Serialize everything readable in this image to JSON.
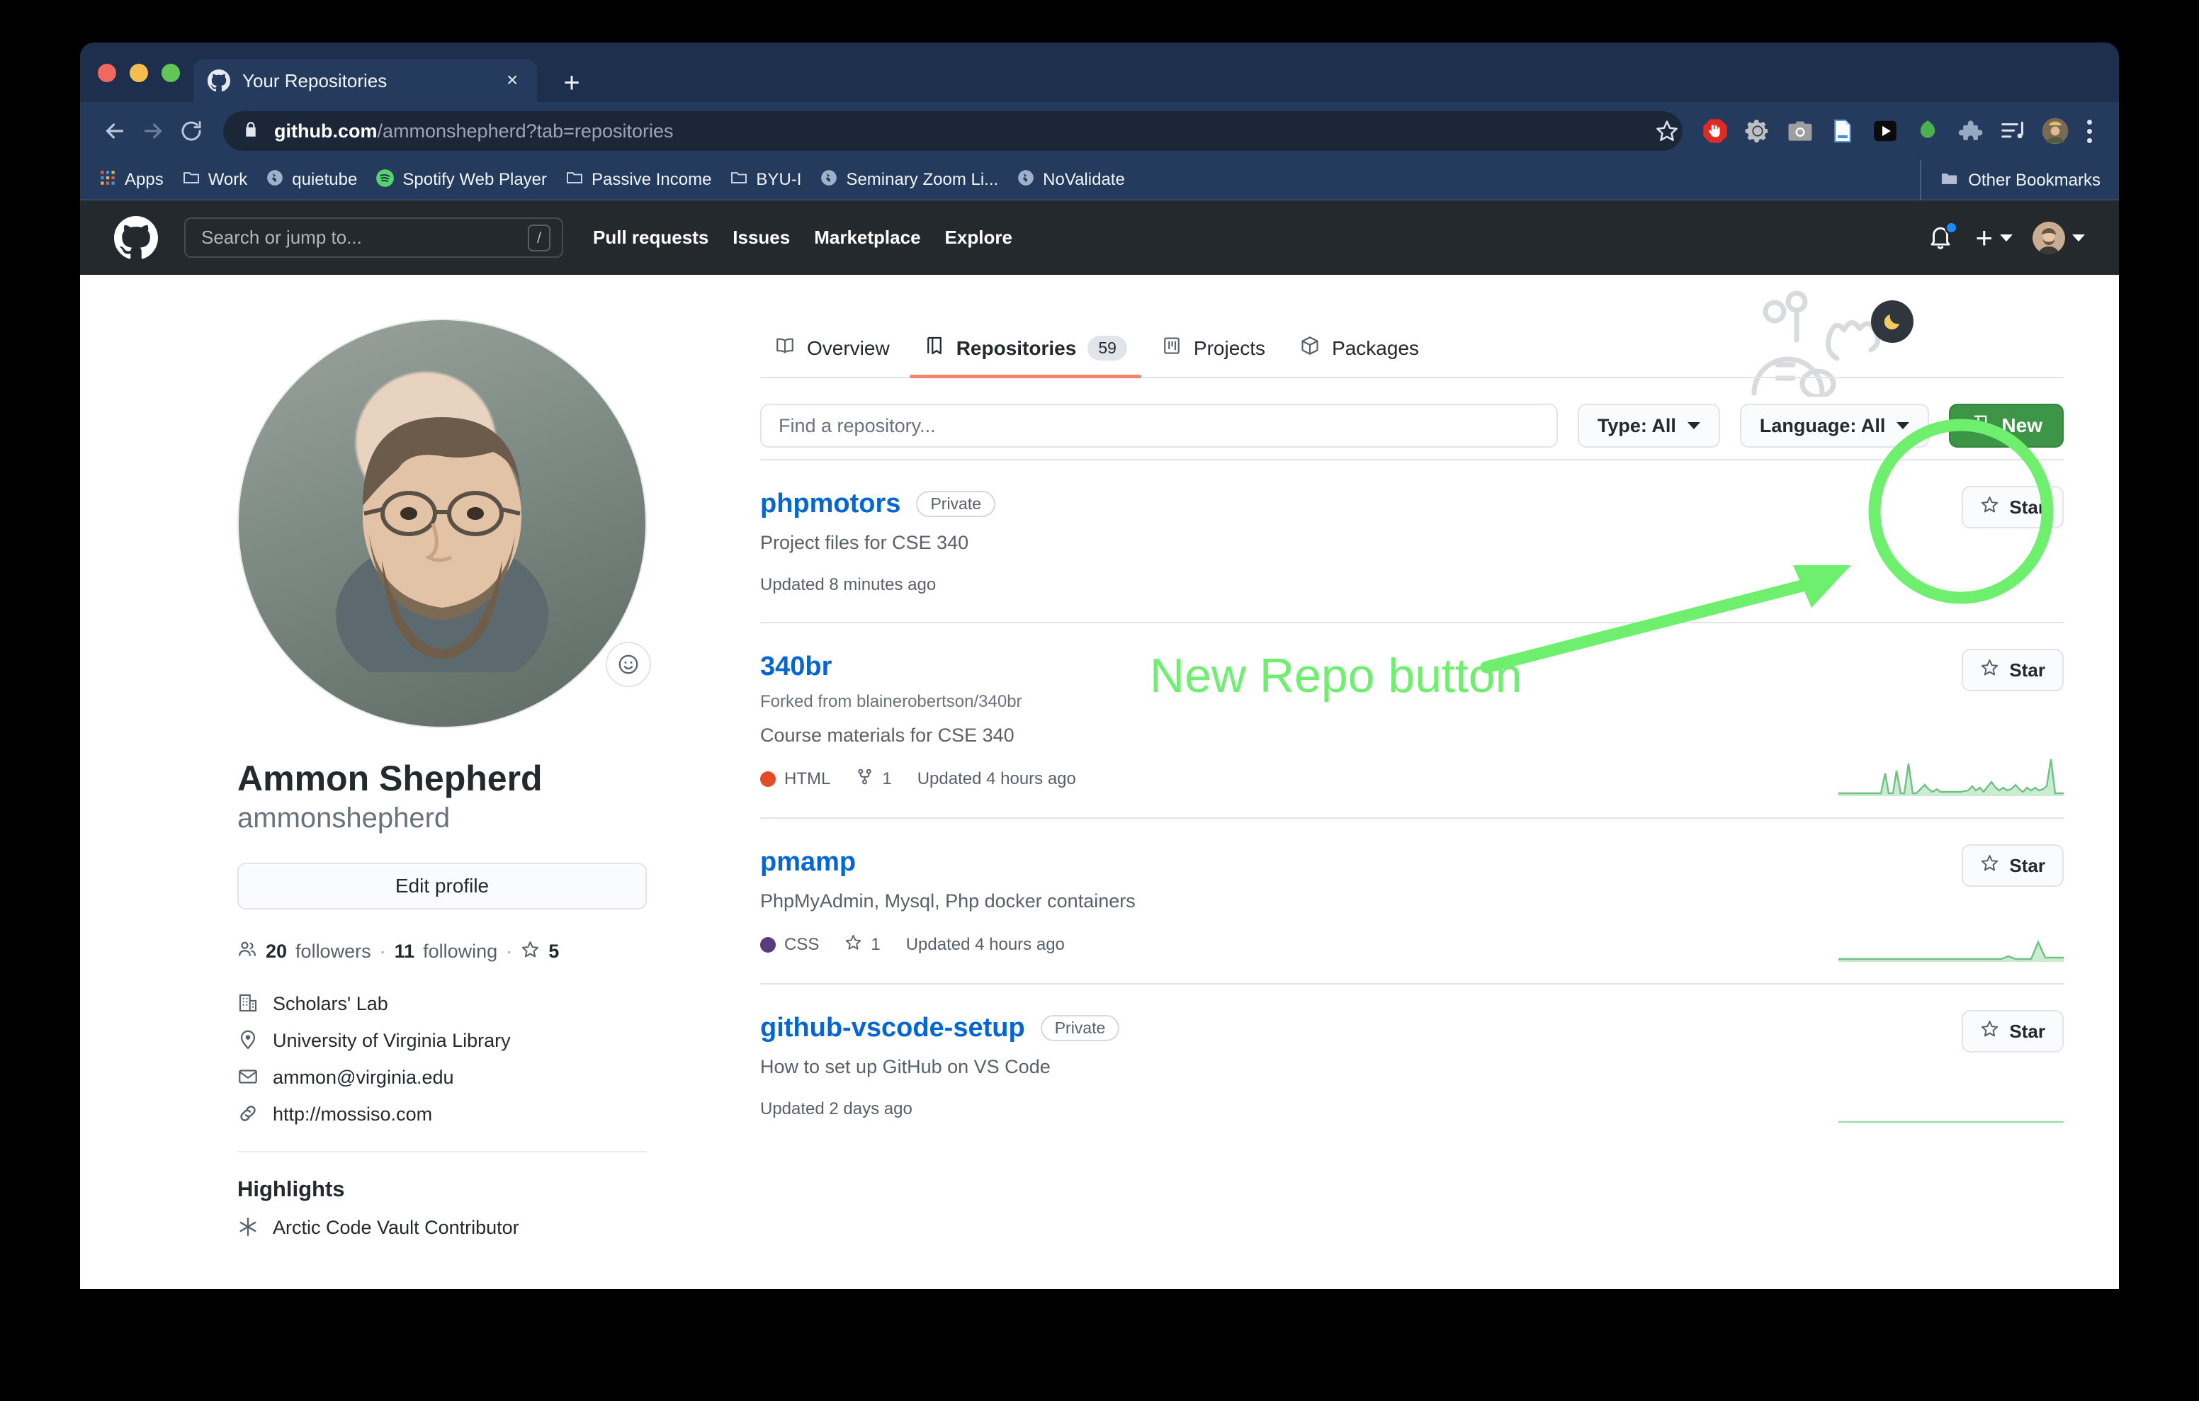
{
  "browser": {
    "tab": {
      "title": "Your Repositories",
      "favicon": "github-icon",
      "close": "×"
    },
    "new_tab_label": "+",
    "traffic_lights": [
      {
        "name": "close",
        "color": "#f2685e"
      },
      {
        "name": "minimize",
        "color": "#f5bd4f"
      },
      {
        "name": "maximize",
        "color": "#62c554"
      }
    ],
    "nav": {
      "back": "←",
      "forward": "→",
      "reload": "⟳"
    },
    "url": {
      "host": "github.com",
      "path": "/ammonshepherd?tab=repositories"
    },
    "extensions": [
      {
        "name": "adblock-icon"
      },
      {
        "name": "gear-icon"
      },
      {
        "name": "camera-icon"
      },
      {
        "name": "document-icon"
      },
      {
        "name": "play-icon"
      },
      {
        "name": "green-drop-icon"
      },
      {
        "name": "puzzle-icon"
      },
      {
        "name": "playlist-icon"
      },
      {
        "name": "profile-avatar-icon"
      }
    ],
    "bookmarks": [
      {
        "label": "Apps",
        "icon": "apps-grid-icon"
      },
      {
        "label": "Work",
        "icon": "folder-icon"
      },
      {
        "label": "quietube",
        "icon": "globe-icon"
      },
      {
        "label": "Spotify Web Player",
        "icon": "spotify-icon"
      },
      {
        "label": "Passive Income",
        "icon": "folder-icon"
      },
      {
        "label": "BYU-I",
        "icon": "folder-icon"
      },
      {
        "label": "Seminary Zoom Li...",
        "icon": "globe-icon"
      },
      {
        "label": "NoValidate",
        "icon": "globe-icon"
      }
    ],
    "other_bookmarks": {
      "label": "Other Bookmarks",
      "icon": "folder-icon"
    }
  },
  "github": {
    "header": {
      "logo": "github-mark-icon",
      "search_placeholder": "Search or jump to...",
      "search_shortcut": "/",
      "nav": [
        {
          "label": "Pull requests"
        },
        {
          "label": "Issues"
        },
        {
          "label": "Marketplace"
        },
        {
          "label": "Explore"
        }
      ],
      "bell": "notifications-bell-icon",
      "plus": "+",
      "avatar": "user-avatar-icon"
    },
    "profile": {
      "name": "Ammon Shepherd",
      "login": "ammonshepherd",
      "edit_button": "Edit profile",
      "stats": {
        "followers_count": "20",
        "followers_label": "followers",
        "following_count": "11",
        "following_label": "following",
        "stars_count": "5"
      },
      "details": [
        {
          "icon": "organization-icon",
          "text": "Scholars' Lab"
        },
        {
          "icon": "location-icon",
          "text": "University of Virginia Library"
        },
        {
          "icon": "mail-icon",
          "text": "ammon@virginia.edu"
        },
        {
          "icon": "link-icon",
          "text": "http://mossiso.com"
        }
      ],
      "highlights_title": "Highlights",
      "highlights": [
        {
          "icon": "arctic-vault-icon",
          "text": "Arctic Code Vault Contributor"
        }
      ]
    },
    "tabs": [
      {
        "label": "Overview",
        "icon": "book-icon",
        "count": null,
        "active": false
      },
      {
        "label": "Repositories",
        "icon": "repo-icon",
        "count": "59",
        "active": true
      },
      {
        "label": "Projects",
        "icon": "project-icon",
        "count": null,
        "active": false
      },
      {
        "label": "Packages",
        "icon": "package-icon",
        "count": null,
        "active": false
      }
    ],
    "filters": {
      "find_placeholder": "Find a repository...",
      "type_label": "Type: All",
      "language_label": "Language: All",
      "new_button": "New",
      "new_button_icon": "repo-icon",
      "new_button_color": "#3d9648"
    },
    "dark_mode_toggle": "moon-icon",
    "star_button_label": "Star",
    "repositories": [
      {
        "name": "phpmotors",
        "badge": "Private",
        "forked_from": null,
        "description": "Project files for CSE 340",
        "language": null,
        "language_color": null,
        "forks": null,
        "stars": null,
        "updated": "Updated 8 minutes ago",
        "star_label": "Star",
        "sparkline": null
      },
      {
        "name": "340br",
        "badge": null,
        "forked_from": "Forked from blainerobertson/340br",
        "description": "Course materials for CSE 340",
        "language": "HTML",
        "language_color": "#e34c26",
        "forks": "1",
        "stars": null,
        "updated": "Updated 4 hours ago",
        "star_label": "Star",
        "sparkline": [
          2,
          2,
          2,
          2,
          2,
          2,
          2,
          2,
          2,
          2,
          2,
          2,
          2,
          2,
          2,
          2,
          2,
          2,
          2,
          2,
          2,
          22,
          2,
          2,
          30,
          2,
          2,
          38,
          2,
          2,
          2,
          2,
          8,
          2,
          4,
          2,
          2,
          2,
          2,
          2,
          2,
          2,
          2,
          2,
          2,
          2,
          8,
          4,
          10,
          4,
          12,
          6,
          14,
          4,
          2,
          2,
          2,
          32
        ]
      },
      {
        "name": "pmamp",
        "badge": null,
        "forked_from": null,
        "description": "PhpMyAdmin, Mysql, Php docker containers",
        "language": "CSS",
        "language_color": "#563d7c",
        "forks": null,
        "stars": "1",
        "updated": "Updated 4 hours ago",
        "star_label": "Star",
        "sparkline": [
          2,
          2,
          2,
          2,
          2,
          2,
          2,
          2,
          2,
          2,
          2,
          2,
          2,
          2,
          2,
          2,
          2,
          2,
          2,
          2,
          2,
          2,
          2,
          2,
          2,
          2,
          2,
          2,
          2,
          2,
          2,
          2,
          2,
          2,
          2,
          2,
          2,
          2,
          2,
          2,
          2,
          2,
          2,
          2,
          2,
          2,
          2,
          2,
          2,
          4,
          2,
          2,
          2,
          2,
          2,
          2,
          22,
          4
        ]
      },
      {
        "name": "github-vscode-setup",
        "badge": "Private",
        "forked_from": null,
        "description": "How to set up GitHub on VS Code",
        "language": null,
        "language_color": null,
        "forks": null,
        "stars": null,
        "updated": "Updated 2 days ago",
        "star_label": "Star",
        "sparkline": [
          2,
          2,
          2,
          2,
          2,
          2,
          2,
          2,
          2,
          2,
          2,
          2,
          2,
          2,
          2,
          2,
          2,
          2,
          2,
          2,
          2,
          2,
          2,
          2,
          2,
          2,
          2,
          2,
          2,
          2,
          2,
          2,
          2,
          2,
          2,
          2,
          2,
          2,
          2,
          2,
          2,
          2,
          2,
          2,
          2,
          2,
          2,
          2,
          2,
          2,
          2,
          2,
          2,
          2,
          2,
          2,
          2,
          2
        ]
      }
    ]
  },
  "annotation": {
    "text": "New Repo button",
    "color": "#6ef06e",
    "circle_target": "new-repo-button"
  }
}
